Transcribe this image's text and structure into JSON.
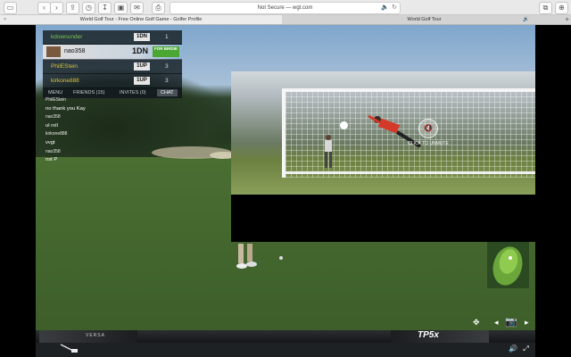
{
  "browser": {
    "url": "Not Secure — wgt.com",
    "tabs": [
      {
        "label": "World Golf Tour - Free Online Golf Game - Golfer Profile"
      },
      {
        "label": "World Golf Tour"
      }
    ]
  },
  "scoreboard": {
    "rows": [
      {
        "name": "kdownunder",
        "status": "1DN",
        "score": "1"
      },
      {
        "name": "nao358",
        "status": "1DN",
        "badge": "FOR BIRDIE"
      },
      {
        "name": "PhilEStein",
        "status": "1UP",
        "score": "3"
      },
      {
        "name": "kirkone888",
        "status": "1UP",
        "score": "3"
      }
    ],
    "tabs": [
      "MENU",
      "FRIENDS (15)",
      "INVITES (0)",
      "CHAT"
    ]
  },
  "chat": [
    {
      "user": "PhilEStein",
      "text": "no thank you Kay"
    },
    {
      "user": "nao358",
      "text": "ul  roll"
    },
    {
      "user": "kirkone888",
      "text": "vvgt"
    },
    {
      "user": "nao358",
      "text": "nst  P"
    }
  ],
  "video": {
    "unmute_label": "CLICK TO UNMUTE"
  },
  "clubs": {
    "left": "VERSA",
    "right": "TP5x"
  },
  "colors": {
    "birdie": "#4aa832",
    "yellow_name": "#d6c23a",
    "green_name": "#79c352"
  }
}
